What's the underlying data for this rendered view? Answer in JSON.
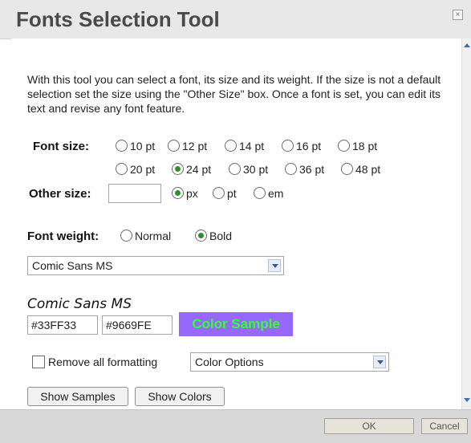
{
  "window": {
    "title": "Fonts Selection Tool",
    "close_glyph": "×"
  },
  "intro": "With this tool you can select a font, its size and its weight. If the size is not a default selection set the size using the \"Other Size\" box. Once a font is set, you can edit its text and revise any font feature.",
  "font_size": {
    "label": "Font size:",
    "options": [
      "10 pt",
      "12 pt",
      "14 pt",
      "16 pt",
      "18 pt",
      "20 pt",
      "24 pt",
      "30 pt",
      "36 pt",
      "48 pt"
    ],
    "selected": "24 pt"
  },
  "other_size": {
    "label": "Other size:",
    "value": "",
    "units": [
      "px",
      "pt",
      "em"
    ],
    "selected_unit": "px"
  },
  "font_weight": {
    "label": "Font weight:",
    "options": [
      "Normal",
      "Bold"
    ],
    "selected": "Bold"
  },
  "font_select": {
    "value": "Comic Sans MS"
  },
  "preview": {
    "font_name": "Comic Sans MS",
    "fg_color": "#33FF33",
    "bg_color": "#9669FE",
    "sample_text": "Color Sample"
  },
  "formatting": {
    "remove_label": "Remove all formatting",
    "remove_checked": false,
    "color_options_value": "Color Options"
  },
  "buttons": {
    "show_samples": "Show Samples",
    "show_colors": "Show Colors"
  },
  "footer": {
    "ok": "OK",
    "cancel": "Cancel"
  },
  "colors": {
    "accent_green": "#2f8f2f",
    "titlebar": "#e8e8e8"
  }
}
